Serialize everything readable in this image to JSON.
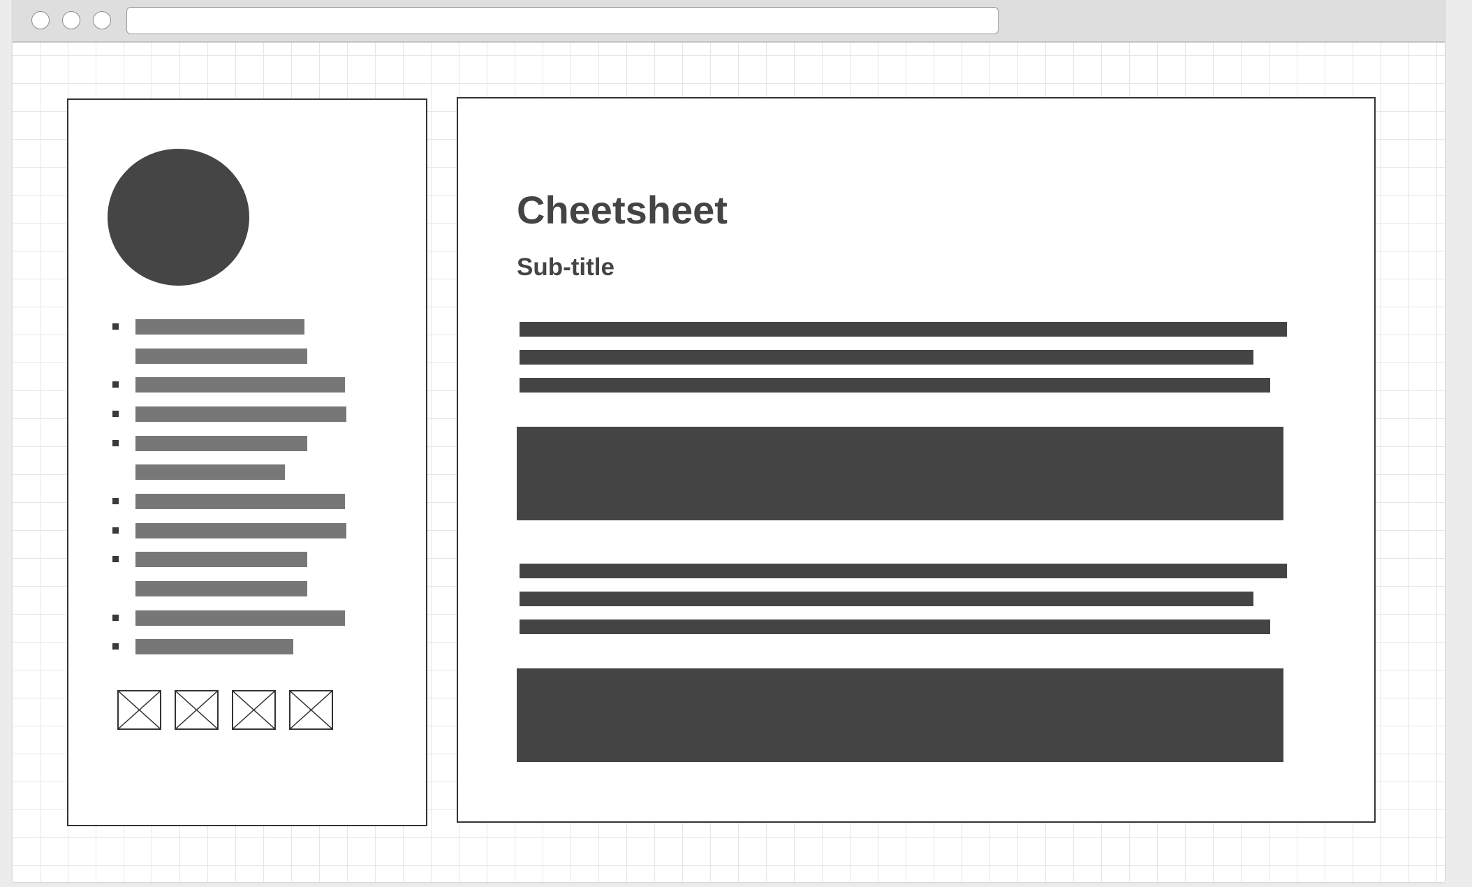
{
  "browser": {
    "controls": [
      "close",
      "minimize",
      "maximize"
    ],
    "address_text": ""
  },
  "sidebar": {
    "avatar": "avatar-placeholder",
    "nav_items": [
      {
        "label": "",
        "has_bullet": true
      },
      {
        "label": "",
        "has_bullet": false
      },
      {
        "label": "",
        "has_bullet": true
      },
      {
        "label": "",
        "has_bullet": true
      },
      {
        "label": "",
        "has_bullet": true
      },
      {
        "label": "",
        "has_bullet": false
      },
      {
        "label": "",
        "has_bullet": true
      },
      {
        "label": "",
        "has_bullet": true
      },
      {
        "label": "",
        "has_bullet": true
      },
      {
        "label": "",
        "has_bullet": false
      },
      {
        "label": "",
        "has_bullet": true
      },
      {
        "label": "",
        "has_bullet": true
      }
    ],
    "image_placeholders": [
      "image-placeholder",
      "image-placeholder",
      "image-placeholder",
      "image-placeholder"
    ]
  },
  "main": {
    "title": "Cheetsheet",
    "subtitle": "Sub-title",
    "sections": [
      {
        "text_lines": 3,
        "block": "content-block"
      },
      {
        "text_lines": 3,
        "block": "content-block"
      }
    ]
  },
  "colors": {
    "grid_line": "#e6e6e6",
    "panel_border": "#333333",
    "dark_fill": "#444444",
    "nav_bar_fill": "#777777",
    "titlebar": "#dedede"
  }
}
